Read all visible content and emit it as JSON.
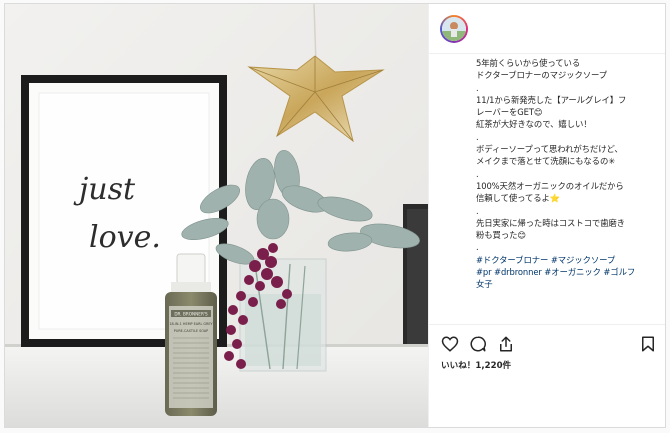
{
  "post": {
    "caption_lines": [
      {
        "text": "5年前くらいから使っている",
        "tag": false
      },
      {
        "text": "ドクターブロナーのマジックソープ",
        "tag": false
      },
      {
        "text": ".",
        "tag": false
      },
      {
        "text": "11/1から新発売した【アールグレイ】フ",
        "tag": false
      },
      {
        "text": "レーバーをGET😊",
        "tag": false
      },
      {
        "text": "紅茶が大好きなので、嬉しい！",
        "tag": false
      },
      {
        "text": ".",
        "tag": false
      },
      {
        "text": "ボディーソープって思われがちだけど、",
        "tag": false
      },
      {
        "text": "メイクまで落とせて洗顔にもなるの✳︎",
        "tag": false
      },
      {
        "text": ".",
        "tag": false
      },
      {
        "text": "100%天然オーガニックのオイルだから",
        "tag": false
      },
      {
        "text": "信頼して使ってるよ⭐",
        "tag": false
      },
      {
        "text": ".",
        "tag": false
      },
      {
        "text": "先日実家に帰った時はコストコで歯磨き",
        "tag": false
      },
      {
        "text": "粉も買った😊",
        "tag": false
      },
      {
        "text": ".",
        "tag": false
      },
      {
        "text": "#ドクターブロナー #マジックソープ",
        "tag": true
      },
      {
        "text": "#pr #drbronner #オーガニック #ゴルフ",
        "tag": true
      },
      {
        "text": "女子",
        "tag": true
      }
    ],
    "likes": "いいね！1,220件"
  },
  "photo": {
    "print_text_line1": "just",
    "print_text_line2": "love.",
    "bottle_brand": "DR. BRONNER'S",
    "bottle_line1": "18-IN-1 HEMP EARL GREY",
    "bottle_line2": "PURE-CASTILE SOAP"
  },
  "icons": {
    "heart": "heart-icon",
    "comment": "comment-icon",
    "share": "share-icon",
    "bookmark": "bookmark-icon"
  }
}
